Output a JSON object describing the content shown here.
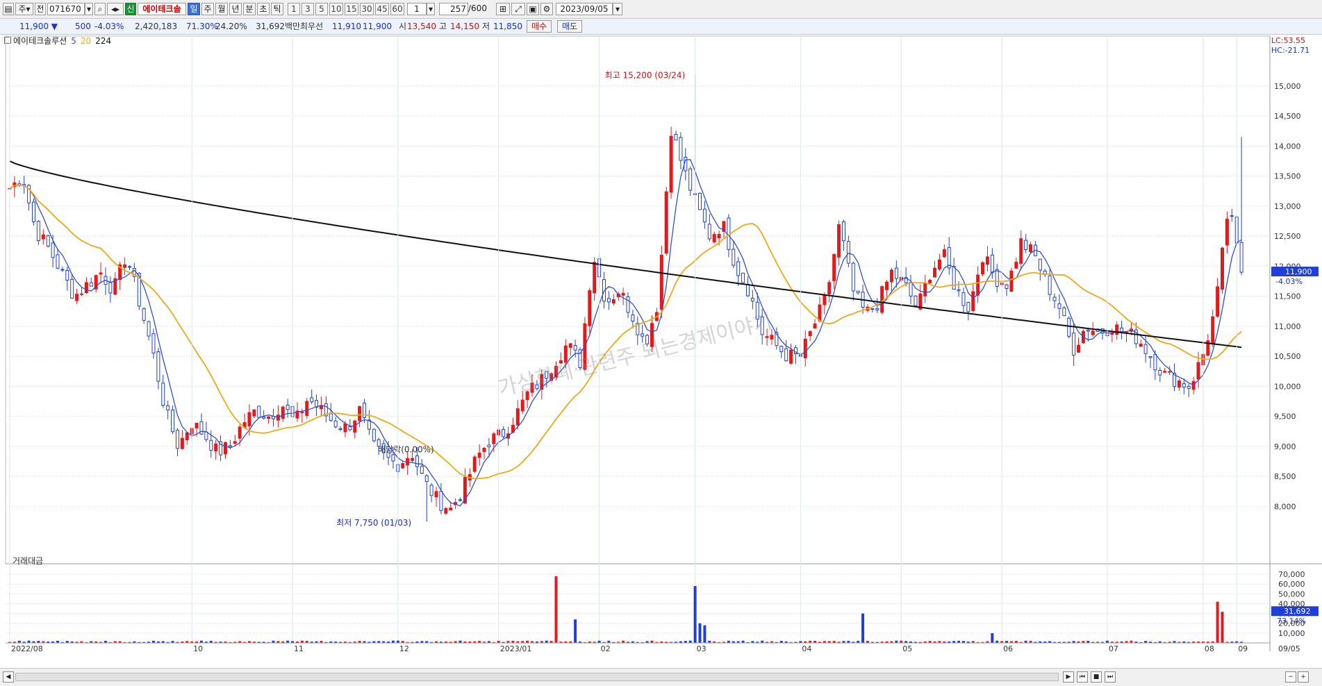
{
  "toolbar": {
    "market": "주",
    "market2": "전",
    "code": "071670",
    "type_badge": "신",
    "stock_name": "에이테크솔",
    "periods": [
      "일",
      "주",
      "월",
      "년",
      "분",
      "초",
      "틱"
    ],
    "active_period": "일",
    "minute_units": [
      "1",
      "3",
      "5",
      "10",
      "15",
      "30",
      "45",
      "60"
    ],
    "unit_value": "1",
    "count": "257",
    "count_total": "/600",
    "date": "2023/09/05"
  },
  "info": {
    "price": "11,900 ▼",
    "change": "500",
    "change_pct": "-4.03%",
    "volume": "2,420,183",
    "vol_ratio": "71.30%",
    "turnover": "24.20%",
    "amount": "31,692백만",
    "best_ask_label": "최우선",
    "best_ask": "11,910",
    "best_bid": "11,900",
    "open_label": "시",
    "open": "13,540",
    "high_label": "고",
    "high": "14,150",
    "low_label": "저",
    "low": "11,850",
    "buy_label": "매수",
    "sell_label": "매도"
  },
  "legend": {
    "name": "에이테크솔루션",
    "ma1": "5",
    "ma2": "20",
    "ma3": "224",
    "volume_title": "거래대금"
  },
  "colors": {
    "up": "#e31a1c",
    "down": "#1f3fd6",
    "ma5": "#2f4fd8",
    "ma20": "#f0a818",
    "ma224": "#111111",
    "grid": "#dde4ee"
  },
  "chart_data": {
    "type": "candlestick",
    "title": "에이테크솔루션",
    "y_axis": {
      "min": 7600,
      "max": 15600,
      "ticks": [
        8000,
        8500,
        9000,
        9500,
        10000,
        10500,
        11000,
        11500,
        12000,
        12500,
        13000,
        13500,
        14000,
        14500,
        15000
      ],
      "tick_labels": [
        "8,000",
        "8,500",
        "9,000",
        "9,500",
        "10,000",
        "10,500",
        "11,000",
        "11,500",
        "12,000",
        "12,500",
        "13,000",
        "13,500",
        "14,000",
        "14,500",
        "15,000"
      ]
    },
    "x_axis": {
      "labels": [
        "2022/08",
        "10",
        "11",
        "12",
        "2023/01",
        "02",
        "03",
        "04",
        "05",
        "06",
        "07",
        "08",
        "09",
        "09/05"
      ]
    },
    "current_price_label": "11,900",
    "current_pct_label": "-4.03%",
    "lc_label": "LC:53.55",
    "hc_label": "HC:-21.71",
    "annotations": {
      "high": "최고 15,200 (03/24)",
      "low": "최저 7,750 (01/03)",
      "dividend": "배당락(0.00%)"
    },
    "watermark": "가상화폐·관련주 되는경제이야기",
    "ohlc_anchors": [
      [
        "2022/08",
        13300
      ],
      [
        "",
        13500
      ],
      [
        "",
        12600
      ],
      [
        "",
        12300
      ],
      [
        "",
        11900
      ],
      [
        "",
        11500
      ],
      [
        "",
        11700
      ],
      [
        "",
        11900
      ],
      [
        "",
        11600
      ],
      [
        "",
        12200
      ],
      [
        "",
        11400
      ],
      [
        "",
        10600
      ],
      [
        "",
        9600
      ],
      [
        "",
        9000
      ],
      [
        "",
        9400
      ],
      [
        "",
        9200
      ],
      [
        "",
        8900
      ],
      [
        "",
        9000
      ],
      [
        "",
        9400
      ],
      [
        "",
        9600
      ],
      [
        "",
        9500
      ],
      [
        "",
        9700
      ],
      [
        "",
        9400
      ],
      [
        "",
        9800
      ],
      [
        "",
        9600
      ],
      [
        "",
        9400
      ],
      [
        "",
        9300
      ],
      [
        "",
        9600
      ],
      [
        "",
        9000
      ],
      [
        "",
        8800
      ],
      [
        "",
        8700
      ],
      [
        "",
        8900
      ],
      [
        "",
        8400
      ],
      [
        "",
        8100
      ],
      [
        "",
        7950
      ],
      [
        "",
        8300
      ],
      [
        "",
        8800
      ],
      [
        "",
        9100
      ],
      [
        "",
        9200
      ],
      [
        "",
        9500
      ],
      [
        "",
        9900
      ],
      [
        "",
        10100
      ],
      [
        "",
        10400
      ],
      [
        "",
        10700
      ],
      [
        "",
        10400
      ],
      [
        "",
        12200
      ],
      [
        "",
        11400
      ],
      [
        "",
        11600
      ],
      [
        "",
        11200
      ],
      [
        "",
        10700
      ],
      [
        "",
        11400
      ],
      [
        "",
        14300
      ],
      [
        "",
        13600
      ],
      [
        "",
        13000
      ],
      [
        "",
        12500
      ],
      [
        "",
        12700
      ],
      [
        "",
        12000
      ],
      [
        "",
        11600
      ],
      [
        "",
        10900
      ],
      [
        "",
        10700
      ],
      [
        "",
        10500
      ],
      [
        "",
        10500
      ],
      [
        "",
        11000
      ],
      [
        "",
        11500
      ],
      [
        "",
        12700
      ],
      [
        "",
        11600
      ],
      [
        "",
        11200
      ],
      [
        "",
        11400
      ],
      [
        "",
        11900
      ],
      [
        "",
        11700
      ],
      [
        "",
        11300
      ],
      [
        "",
        11900
      ],
      [
        "",
        12200
      ],
      [
        "",
        11600
      ],
      [
        "",
        11300
      ],
      [
        "",
        12200
      ],
      [
        "",
        11800
      ],
      [
        "",
        11700
      ],
      [
        "",
        12400
      ],
      [
        "",
        12200
      ],
      [
        "",
        11700
      ],
      [
        "",
        11300
      ],
      [
        "",
        10600
      ],
      [
        "",
        11000
      ],
      [
        "",
        10900
      ],
      [
        "",
        11000
      ],
      [
        "",
        10900
      ],
      [
        "",
        10800
      ],
      [
        "",
        10500
      ],
      [
        "",
        10200
      ],
      [
        "",
        10100
      ],
      [
        "",
        10000
      ],
      [
        "",
        10500
      ],
      [
        "",
        11300
      ],
      [
        "",
        13000
      ],
      [
        "",
        11900
      ]
    ],
    "ma_notes": "Moving averages 5 / 20 / 224",
    "volume": {
      "title": "거래대금",
      "y_ticks": [
        10000,
        20000,
        30000,
        40000,
        50000,
        60000,
        70000
      ],
      "y_tick_labels": [
        "10,000",
        "20,000",
        "30,000",
        "40,000",
        "50,000",
        "60,000",
        "70,000"
      ],
      "last_value_label": "31,692",
      "last_pct_label": "73.14%"
    }
  }
}
